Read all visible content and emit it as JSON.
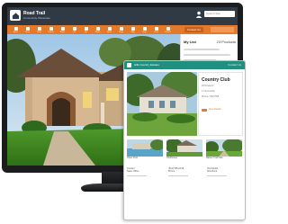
{
  "app": {
    "title": "Road Trail",
    "subtitle": "Community Showcase",
    "search_placeholder": "Search Site"
  },
  "nav": {
    "items": [
      "Home",
      "Tours",
      "Plans",
      "Homes",
      "Areas",
      "Life",
      "Info",
      "Media",
      "News",
      "Maps",
      "Blog",
      "Help",
      "Team",
      "Contact"
    ],
    "primary_button": "Contact Us"
  },
  "listing": {
    "title": "My List",
    "count": "23 Products"
  },
  "tablet": {
    "header_title": "Hills Country Estates",
    "header_right": "Contact Us",
    "card": {
      "title": "Country Club",
      "lines": [
        "24 Products",
        "1 Community",
        "Phone: (512) 555"
      ],
      "link": "View Details"
    },
    "thumbs": [
      "Open Pool",
      "Clubhouse",
      "Nature Trail Park"
    ],
    "info": [
      {
        "line1": "Contact",
        "line2": "Sales Office"
      },
      {
        "line1": "(512) 555-0148",
        "line2": "Phone"
      },
      {
        "line1": "Visit Model",
        "line2": "Directions"
      }
    ]
  },
  "colors": {
    "topbar": "#2f3a45",
    "accent": "#e37a2b",
    "tablet_header": "#1f8f80"
  }
}
